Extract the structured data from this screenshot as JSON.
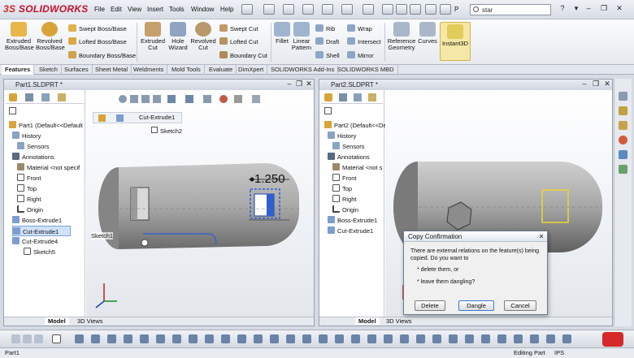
{
  "app": {
    "logo": "SOLIDWORKS",
    "logo_ds": "3S"
  },
  "menu": [
    "File",
    "Edit",
    "View",
    "Insert",
    "Tools",
    "Window",
    "Help"
  ],
  "search": {
    "value": "star",
    "prefix": "P"
  },
  "cmd": {
    "big": [
      {
        "label": "Extruded\nBoss/Base",
        "icon": "extruded-boss-icon",
        "color": "#e8b64a"
      },
      {
        "label": "Revolved\nBoss/Base",
        "icon": "revolved-boss-icon",
        "color": "#d8a43a"
      },
      {
        "label": "Extruded\nCut",
        "icon": "extruded-cut-icon",
        "color": "#c6a06a"
      },
      {
        "label": "Hole\nWizard",
        "icon": "hole-wizard-icon",
        "color": "#8fa4c0"
      },
      {
        "label": "Revolved\nCut",
        "icon": "revolved-cut-icon",
        "color": "#b9986b"
      },
      {
        "label": "Fillet",
        "icon": "fillet-icon",
        "color": "#9fb4cf"
      },
      {
        "label": "Linear\nPattern",
        "icon": "linear-pattern-icon",
        "color": "#9fb4cf"
      },
      {
        "label": "Reference\nGeometry",
        "icon": "reference-geometry-icon",
        "color": "#a9b7c9"
      },
      {
        "label": "Curves",
        "icon": "curves-icon",
        "color": "#a9b7c9"
      },
      {
        "label": "Instant3D",
        "icon": "instant3d-icon",
        "color": "#e2cc5a"
      }
    ],
    "small": [
      {
        "label": "Swept Boss/Base",
        "icon": "swept-boss-icon"
      },
      {
        "label": "Lofted Boss/Base",
        "icon": "lofted-boss-icon"
      },
      {
        "label": "Boundary Boss/Base",
        "icon": "boundary-boss-icon"
      },
      {
        "label": "Swept Cut",
        "icon": "swept-cut-icon"
      },
      {
        "label": "Lofted Cut",
        "icon": "lofted-cut-icon"
      },
      {
        "label": "Boundary Cut",
        "icon": "boundary-cut-icon"
      },
      {
        "label": "Rib",
        "icon": "rib-icon"
      },
      {
        "label": "Draft",
        "icon": "draft-icon"
      },
      {
        "label": "Shell",
        "icon": "shell-icon"
      },
      {
        "label": "Wrap",
        "icon": "wrap-icon"
      },
      {
        "label": "Intersect",
        "icon": "intersect-icon"
      },
      {
        "label": "Mirror",
        "icon": "mirror-icon"
      }
    ]
  },
  "tabs": [
    "Features",
    "Sketch",
    "Surfaces",
    "Sheet Metal",
    "Weldments",
    "Mold Tools",
    "Evaluate",
    "DimXpert",
    "SOLIDWORKS Add-Ins",
    "SOLIDWORKS MBD"
  ],
  "left_doc": {
    "title": "Part1.SLDPRT *",
    "root": "Part1  (Default<<Default",
    "items": [
      "History",
      "Sensors",
      "Annotations",
      "Material <not specif",
      "Front",
      "Top",
      "Right",
      "Origin",
      "Boss-Extrude1",
      "Cut-Extrude1",
      "Cut-Extrude4",
      "Sketch5"
    ],
    "breadcrumb": "Cut-Extrude1",
    "breadcrumb_sketch": "Sketch2",
    "callout": "Sketch1",
    "dimension": "1.250",
    "bottom_tabs": [
      "Model",
      "3D Views"
    ]
  },
  "right_doc": {
    "title": "Part2.SLDPRT *",
    "root": "Part2  (Default<<De",
    "items": [
      "History",
      "Sensors",
      "Annotations",
      "Material <not s",
      "Front",
      "Top",
      "Right",
      "Origin",
      "Boss-Extrude1",
      "Cut-Extrude1"
    ],
    "bottom_tabs": [
      "Model",
      "3D Views"
    ]
  },
  "dialog": {
    "title": "Copy Confirmation",
    "message": "There are external relations on the feature(s) being copied.  Do you want to",
    "option1": "* delete them, or",
    "option2": "* leave them dangling?",
    "buttons": [
      "Delete",
      "Dangle",
      "Cancel"
    ]
  },
  "status": {
    "left": "Part1",
    "mode": "Editing Part",
    "units": "IPS"
  },
  "colors": {
    "selection": "#2f5fd0",
    "accent": "#c8102e",
    "yellow_sketch": "#e8d23a"
  }
}
